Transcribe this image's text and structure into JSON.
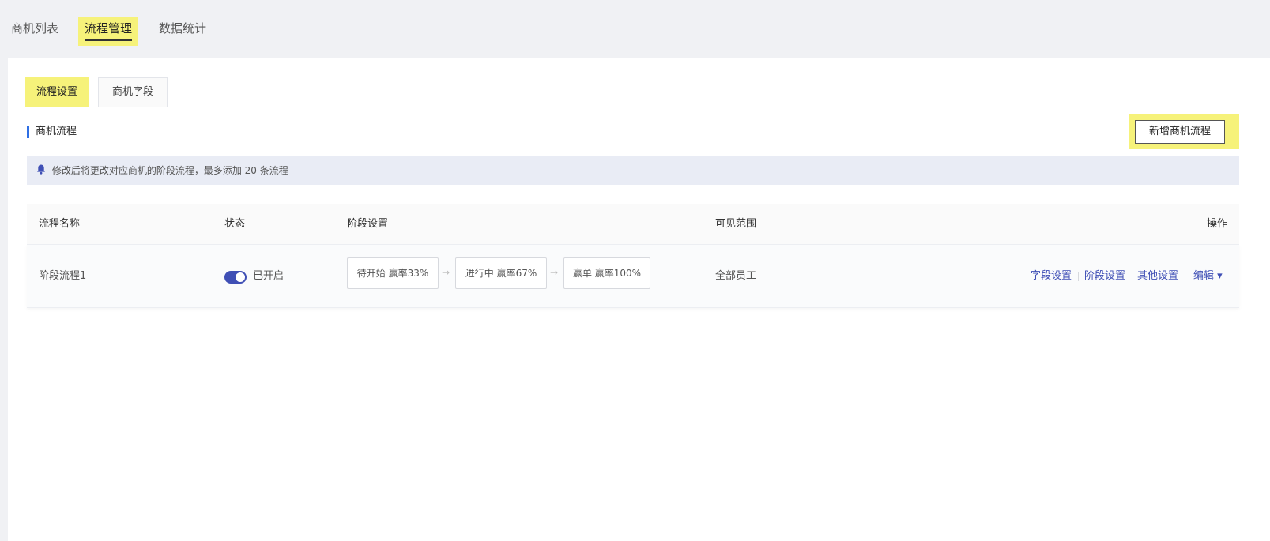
{
  "top_nav": {
    "tabs": [
      {
        "label": "商机列表"
      },
      {
        "label": "流程管理"
      },
      {
        "label": "数据统计"
      }
    ]
  },
  "sub_tabs": [
    {
      "label": "流程设置"
    },
    {
      "label": "商机字段"
    }
  ],
  "section": {
    "title": "商机流程"
  },
  "toolbar": {
    "add_label": "新增商机流程"
  },
  "notice": {
    "icon": "bell-icon",
    "text": "修改后将更改对应商机的阶段流程，最多添加 20 条流程"
  },
  "table": {
    "columns": [
      "流程名称",
      "状态",
      "阶段设置",
      "可见范围",
      "操作"
    ],
    "rows": [
      {
        "name": "阶段流程1",
        "status": "已开启",
        "enabled": true,
        "stages": [
          {
            "label": "待开始  赢率33%"
          },
          {
            "label": "进行中  赢率67%"
          },
          {
            "label": "赢单  赢率100%"
          }
        ],
        "stage_arrow": "→",
        "scope": "全部员工",
        "actions": [
          "字段设置",
          "阶段设置",
          "其他设置",
          "编辑 ▾"
        ]
      }
    ]
  },
  "colors": {
    "highlight": "#f6f27a",
    "accent": "#3f4fb5",
    "section_bar": "#2f6fe4",
    "notice_bg": "#e9ecf5"
  }
}
